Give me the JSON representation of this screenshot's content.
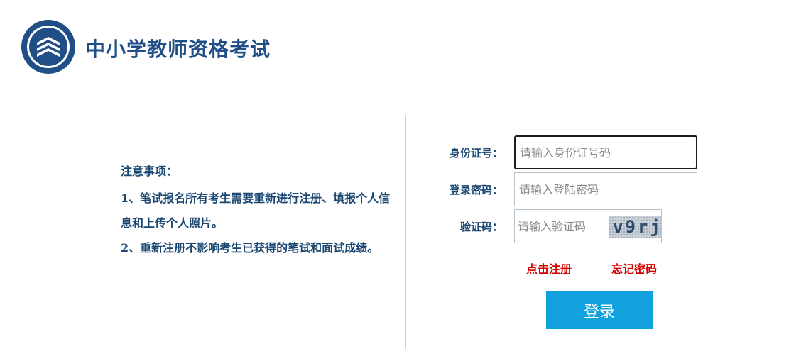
{
  "site": {
    "title": "中小学教师资格考试"
  },
  "notice": {
    "title": "注意事项：",
    "items": [
      "1、笔试报名所有考生需要重新进行注册、填报个人信息和上传个人照片。",
      "2、重新注册不影响考生已获得的笔试和面试成绩。"
    ]
  },
  "login_form": {
    "id_label": "身份证号：",
    "id_placeholder": "请输入身份证号码",
    "password_label": "登录密码：",
    "password_placeholder": "请输入登陆密码",
    "captcha_label": "验证码：",
    "captcha_placeholder": "请输入验证码",
    "captcha_text": "v9rj",
    "register_link": "点击注册",
    "forgot_link": "忘记密码",
    "login_button": "登录"
  },
  "colors": {
    "brand": "#1f4f86",
    "button": "#11a1de",
    "link": "#d40000"
  }
}
